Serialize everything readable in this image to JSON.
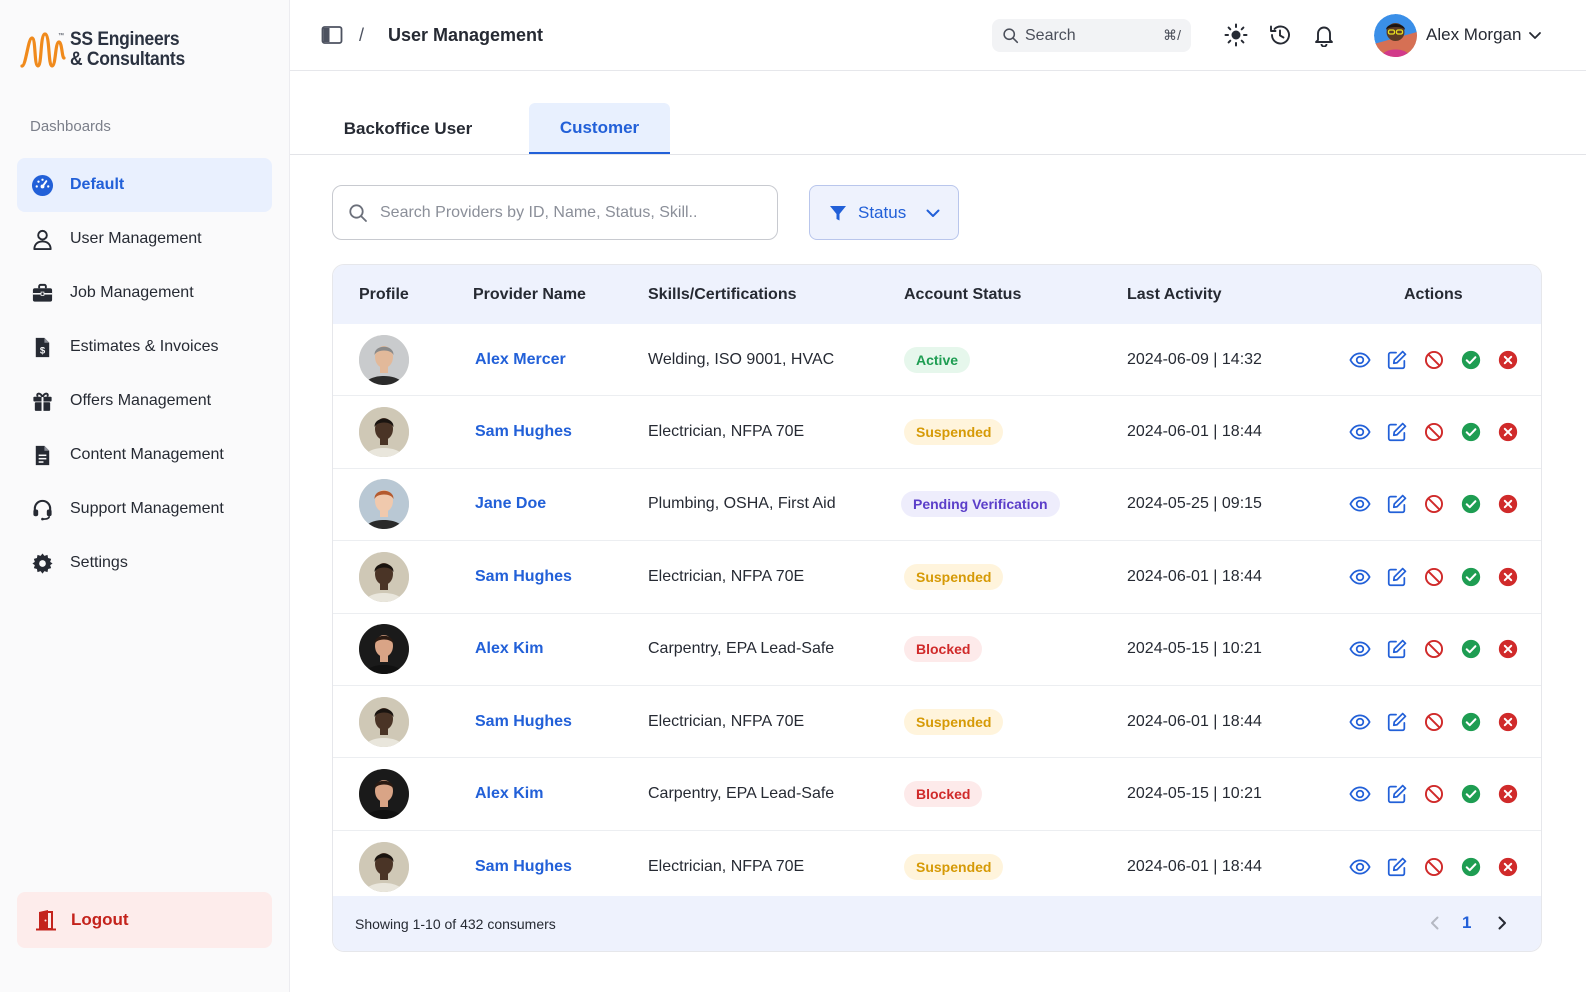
{
  "brand": {
    "line1": "SS Engineers",
    "line2": "& Consultants",
    "accent": "#f08a1c"
  },
  "sidebar": {
    "section_label": "Dashboards",
    "items": [
      {
        "label": "Default",
        "icon": "dashboard-gauge-icon"
      },
      {
        "label": "User Management",
        "icon": "user-icon"
      },
      {
        "label": "Job Management",
        "icon": "briefcase-icon"
      },
      {
        "label": "Estimates & Invoices",
        "icon": "invoice-dollar-icon"
      },
      {
        "label": "Offers Management",
        "icon": "gift-icon"
      },
      {
        "label": "Content Management",
        "icon": "document-icon"
      },
      {
        "label": "Support Management",
        "icon": "headset-icon"
      },
      {
        "label": "Settings",
        "icon": "gear-icon"
      }
    ],
    "logout_label": "Logout"
  },
  "header": {
    "separator": "/",
    "title": "User Management",
    "search_label": "Search",
    "search_shortcut": "⌘/",
    "user_name": "Alex Morgan"
  },
  "tabs": [
    {
      "label": "Backoffice User"
    },
    {
      "label": "Customer"
    }
  ],
  "filters": {
    "search_placeholder": "Search Providers by ID, Name, Status, Skill..",
    "status_label": "Status"
  },
  "table": {
    "columns": [
      "Profile",
      "Provider Name",
      "Skills/Certifications",
      "Account Status",
      "Last Activity",
      "Actions"
    ],
    "rows": [
      {
        "name": "Alex Mercer",
        "skills": "Welding, ISO 9001, HVAC",
        "status": "Active",
        "activity": "2024-06-09 | 14:32"
      },
      {
        "name": "Sam Hughes",
        "skills": "Electrician, NFPA 70E",
        "status": "Suspended",
        "activity": "2024-06-01 | 18:44"
      },
      {
        "name": "Jane Doe",
        "skills": "Plumbing, OSHA, First Aid",
        "status": "Pending Verification",
        "activity": "2024-05-25 | 09:15"
      },
      {
        "name": "Sam Hughes",
        "skills": "Electrician, NFPA 70E",
        "status": "Suspended",
        "activity": "2024-06-01 | 18:44"
      },
      {
        "name": "Alex Kim",
        "skills": "Carpentry, EPA Lead-Safe",
        "status": "Blocked",
        "activity": "2024-05-15 | 10:21"
      },
      {
        "name": "Sam Hughes",
        "skills": "Electrician, NFPA 70E",
        "status": "Suspended",
        "activity": "2024-06-01 | 18:44"
      },
      {
        "name": "Alex Kim",
        "skills": "Carpentry, EPA Lead-Safe",
        "status": "Blocked",
        "activity": "2024-05-15 | 10:21"
      },
      {
        "name": "Sam Hughes",
        "skills": "Electrician, NFPA 70E",
        "status": "Suspended",
        "activity": "2024-06-01 | 18:44"
      }
    ],
    "actions": [
      "view-eye-icon",
      "edit-pencil-icon",
      "block-icon",
      "approve-check-icon",
      "reject-x-icon"
    ]
  },
  "footer": {
    "summary": "Showing 1-10 of 432 consumers",
    "page": "1"
  },
  "colors": {
    "primary": "#2260d8",
    "active": "#1e9d52",
    "suspended": "#d69a06",
    "pending": "#5b3ec9",
    "blocked": "#d02a2a"
  }
}
